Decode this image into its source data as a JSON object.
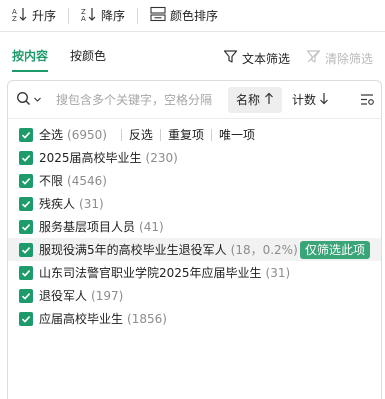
{
  "toolbar": {
    "asc_label": "升序",
    "desc_label": "降序",
    "color_sort_label": "颜色排序"
  },
  "tabs": [
    {
      "label": "按内容",
      "active": true
    },
    {
      "label": "按颜色",
      "active": false
    }
  ],
  "actions": {
    "text_filter": "文本筛选",
    "clear_filter": "清除筛选"
  },
  "search": {
    "placeholder": "搜包含多个关键字，空格分隔",
    "sort_name_label": "名称",
    "sort_count_label": "计数"
  },
  "select_all": {
    "label": "全选",
    "count": "(6950)",
    "links": [
      "反选",
      "重复项",
      "唯一项"
    ]
  },
  "items": [
    {
      "label": "2025届高校毕业生",
      "count": "(230)"
    },
    {
      "label": "不限",
      "count": "(4546)"
    },
    {
      "label": "残疾人",
      "count": "(31)"
    },
    {
      "label": "服务基层项目人员",
      "count": "(41)"
    },
    {
      "label": "服现役满5年的高校毕业生退役军人",
      "count": "(18，0.2%)"
    },
    {
      "label": "山东司法警官职业学院2025年应届毕业生",
      "count": "(31)"
    },
    {
      "label": "退役军人",
      "count": "(197)"
    },
    {
      "label": "应届高校毕业生",
      "count": "(1856)"
    }
  ],
  "only_button_label": "仅筛选此项",
  "colors": {
    "accent": "#1e9b6b",
    "only_button": "#3aa577"
  }
}
